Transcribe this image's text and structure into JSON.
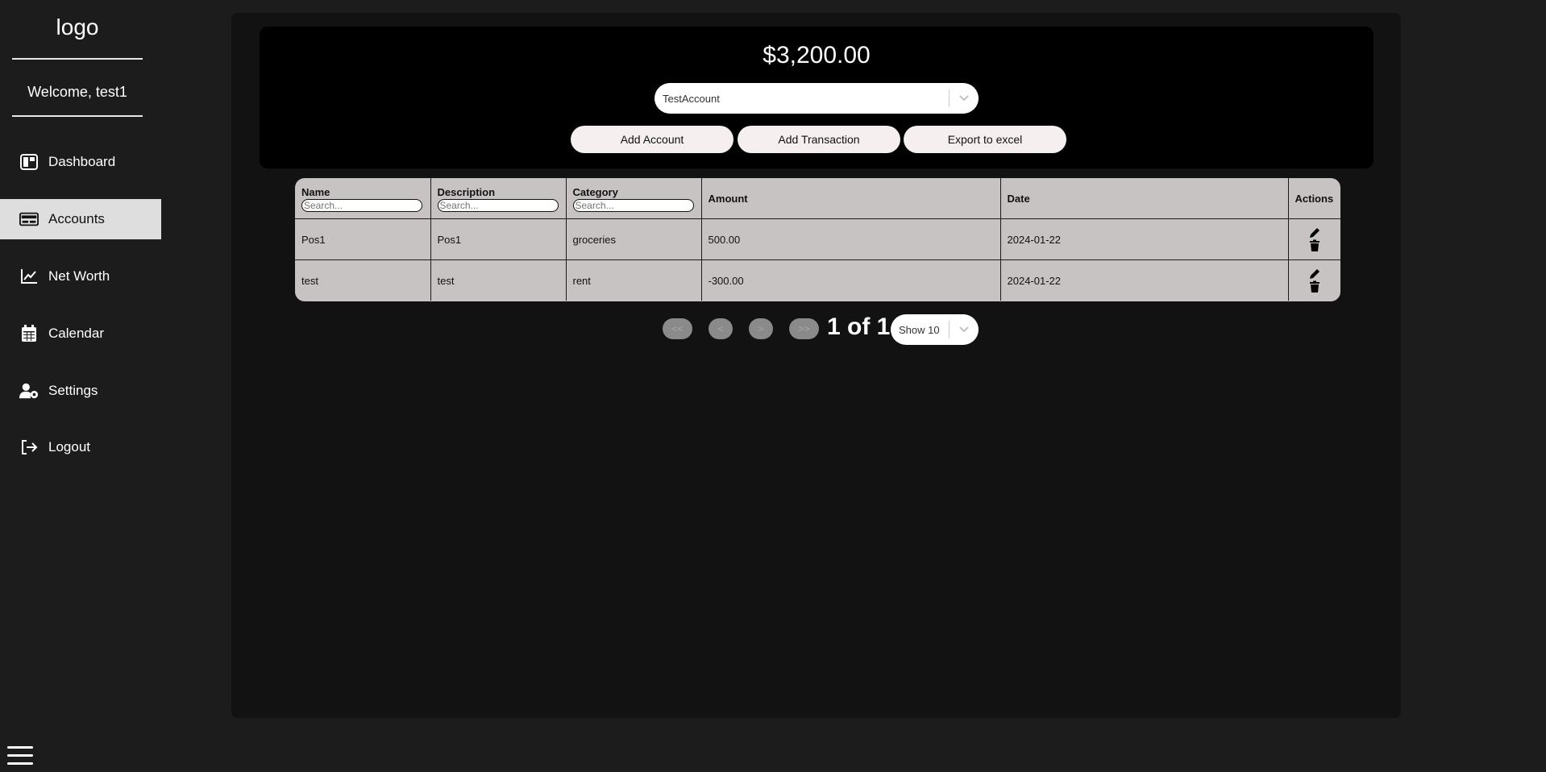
{
  "sidebar": {
    "logo": "logo",
    "welcome": "Welcome, test1",
    "items": [
      {
        "label": "Dashboard",
        "icon": "dashboard-icon",
        "active": false
      },
      {
        "label": "Accounts",
        "icon": "card-icon",
        "active": true
      },
      {
        "label": "Net Worth",
        "icon": "chart-line-icon",
        "active": false
      },
      {
        "label": "Calendar",
        "icon": "calendar-icon",
        "active": false
      },
      {
        "label": "Settings",
        "icon": "user-gear-icon",
        "active": false
      },
      {
        "label": "Logout",
        "icon": "logout-icon",
        "active": false
      }
    ]
  },
  "header": {
    "balance": "$3,200.00",
    "account_select": "TestAccount",
    "buttons": {
      "add_account": "Add Account",
      "add_transaction": "Add Transaction",
      "export": "Export to excel"
    }
  },
  "table": {
    "columns": {
      "name": "Name",
      "description": "Description",
      "category": "Category",
      "amount": "Amount",
      "date": "Date",
      "actions": "Actions"
    },
    "search_placeholder": "Search...",
    "rows": [
      {
        "name": "Pos1",
        "description": "Pos1",
        "category": "groceries",
        "amount": "500.00",
        "date": "2024-01-22"
      },
      {
        "name": "test",
        "description": "test",
        "category": "rent",
        "amount": "-300.00",
        "date": "2024-01-22"
      }
    ]
  },
  "pagination": {
    "first": "<<",
    "prev": "<",
    "next": ">",
    "last": ">>",
    "page_text": "1 of 1",
    "page_size": "Show 10"
  },
  "colors": {
    "background": "#1c1c1c",
    "panel": "#121212",
    "header": "#000000",
    "table": "#c8c3c3",
    "active_nav": "#dedede",
    "button": "#f6efef"
  }
}
